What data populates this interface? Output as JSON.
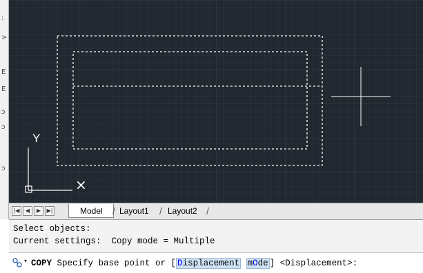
{
  "colors": {
    "canvas_bg": "#212830",
    "crosshair": "#ffffff",
    "dashed_outline": "#ffffff"
  },
  "left_strip_marks": [
    ":",
    ">",
    "E",
    "E",
    "ɔ",
    "ɔ",
    "ɔ"
  ],
  "ucs_icon": {
    "y_label": "Y",
    "x_label": "×"
  },
  "layout_tabs": {
    "nav_buttons": [
      "|◀",
      "◀",
      "▶",
      "▶|"
    ],
    "tabs": [
      "Model",
      "Layout1",
      "Layout2"
    ],
    "active_tab": "Model"
  },
  "command_history": [
    "Select objects:",
    "Current settings:  Copy mode = Multiple"
  ],
  "command_line": {
    "icon": "command-icon",
    "command": "COPY",
    "prompt_before": " Specify base point or [",
    "option_1_hotkey": "D",
    "option_1_rest": "isplacement",
    "option_2_pre": "m",
    "option_2_hotkey": "O",
    "option_2_rest": "de",
    "prompt_after": "] <Displacement>:"
  }
}
